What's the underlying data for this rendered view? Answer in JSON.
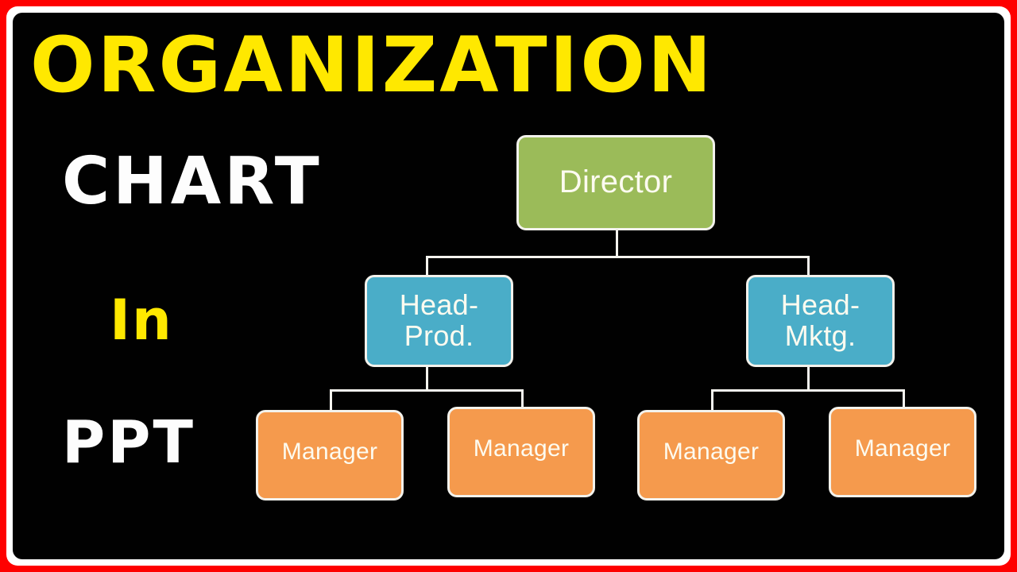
{
  "frame": {
    "outer_color": "#fe0000",
    "inner_color": "#ffffff",
    "stage_color": "#010101"
  },
  "titles": {
    "line1": "ORGANIZATION",
    "line2": "CHART",
    "line3": "In",
    "line4": "PPT",
    "line1_color": "#ffe800",
    "line2_color": "#fdfdfd",
    "line3_color": "#ffe800",
    "line4_color": "#fdfdfd"
  },
  "chart_data": {
    "type": "diagram",
    "title": "Organization Chart",
    "orientation": "top-down",
    "connector_color": "#f5f4ef",
    "levels": [
      {
        "level": 1,
        "role": "director",
        "fill": "#9bbb59",
        "nodes": [
          "Director"
        ]
      },
      {
        "level": 2,
        "role": "head",
        "fill": "#4aadc8",
        "nodes": [
          "Head-Prod.",
          "Head-Mktg."
        ]
      },
      {
        "level": 3,
        "role": "manager",
        "fill": "#f59a4d",
        "nodes": [
          "Manager",
          "Manager",
          "Manager",
          "Manager"
        ]
      }
    ],
    "edges": [
      {
        "from": "Director",
        "to": "Head-Prod."
      },
      {
        "from": "Director",
        "to": "Head-Mktg."
      },
      {
        "from": "Head-Prod.",
        "to": "Manager 1"
      },
      {
        "from": "Head-Prod.",
        "to": "Manager 2"
      },
      {
        "from": "Head-Mktg.",
        "to": "Manager 3"
      },
      {
        "from": "Head-Mktg.",
        "to": "Manager 4"
      }
    ]
  },
  "nodes": {
    "director": {
      "label": "Director"
    },
    "head_prod": {
      "line1": "Head-",
      "line2": "Prod."
    },
    "head_mktg": {
      "line1": "Head-",
      "line2": "Mktg."
    },
    "manager1": {
      "label": "Manager"
    },
    "manager2": {
      "label": "Manager"
    },
    "manager3": {
      "label": "Manager"
    },
    "manager4": {
      "label": "Manager"
    }
  }
}
